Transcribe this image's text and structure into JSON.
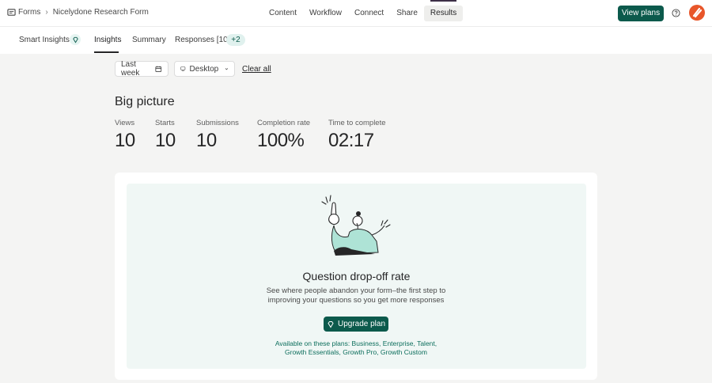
{
  "breadcrumb": {
    "root": "Forms",
    "current": "Nicelydone Research Form"
  },
  "main_nav": [
    {
      "label": "Content"
    },
    {
      "label": "Workflow"
    },
    {
      "label": "Connect"
    },
    {
      "label": "Share"
    },
    {
      "label": "Results",
      "active": true
    }
  ],
  "header": {
    "view_plans": "View plans",
    "avatar_color": "#e8562a"
  },
  "sub_nav": {
    "smart_insights": "Smart Insights",
    "insights": "Insights",
    "summary": "Summary",
    "responses": "Responses [10]",
    "extra": "+2"
  },
  "filters": {
    "date": "Last week",
    "device": "Desktop",
    "clear": "Clear all"
  },
  "big_picture": {
    "title": "Big picture",
    "metrics": [
      {
        "label": "Views",
        "value": "10"
      },
      {
        "label": "Starts",
        "value": "10"
      },
      {
        "label": "Submissions",
        "value": "10"
      },
      {
        "label": "Completion rate",
        "value": "100%"
      },
      {
        "label": "Time to complete",
        "value": "02:17"
      }
    ]
  },
  "dropoff": {
    "title": "Question drop-off rate",
    "description": "See where people abandon your form–the first step to improving your questions so you get more responses",
    "button": "Upgrade plan",
    "plans_line1": "Available on these plans: Business, Enterprise, Talent,",
    "plans_line2": "Growth Essentials, Growth Pro, Growth Custom"
  },
  "colors": {
    "primary": "#0c5a4c",
    "panel_bg": "#f0f7f5",
    "accent_link": "#0c6e5c"
  }
}
